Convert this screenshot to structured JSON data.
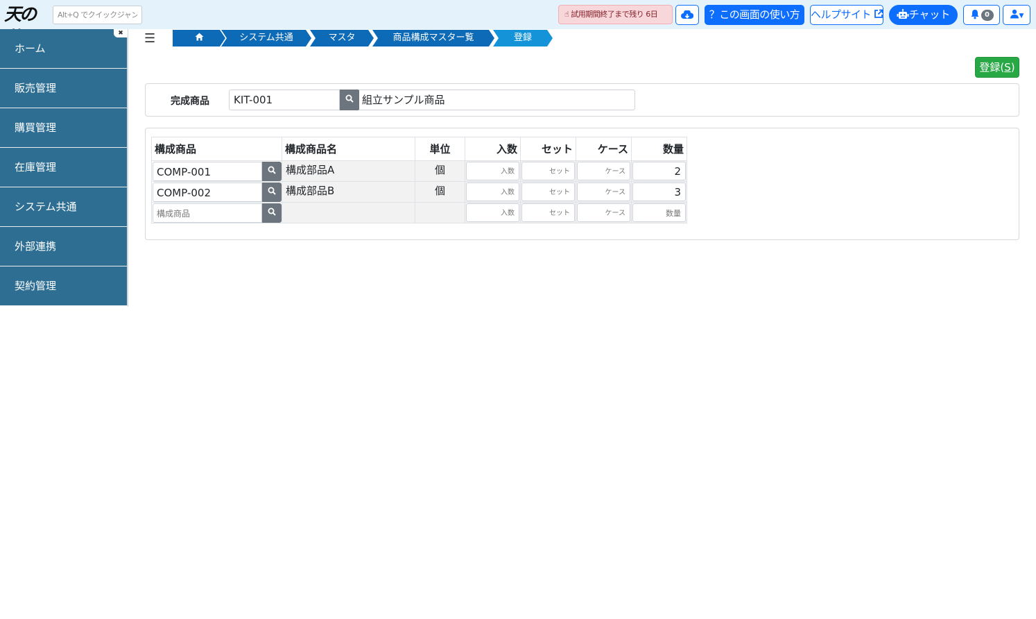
{
  "header": {
    "logo_text": "天の蔵",
    "quickjump_placeholder": "Alt+Q でクイックジャンプ",
    "trial_text": "試用期間終了まで残り 6日",
    "howto_label": "この画面の使い方",
    "help_label": "ヘルプサイト",
    "chat_label": "チャット",
    "notification_count": "0"
  },
  "sidebar": {
    "items": [
      {
        "label": "ホーム"
      },
      {
        "label": "販売管理"
      },
      {
        "label": "購買管理"
      },
      {
        "label": "在庫管理"
      },
      {
        "label": "システム共通"
      },
      {
        "label": "外部連携"
      },
      {
        "label": "契約管理"
      }
    ]
  },
  "breadcrumb": {
    "items": [
      {
        "label": "システム共通"
      },
      {
        "label": "マスタ"
      },
      {
        "label": "商品構成マスター覧"
      },
      {
        "label": "登録"
      }
    ]
  },
  "actions": {
    "register_label": "登録",
    "register_key": "S"
  },
  "finished_product": {
    "label": "完成商品",
    "code": "KIT-001",
    "name": "組立サンプル商品"
  },
  "grid": {
    "columns": {
      "code": "構成商品",
      "name": "構成商品名",
      "unit": "単位",
      "irisu": "入数",
      "set": "セット",
      "case": "ケース",
      "qty": "数量"
    },
    "rows": [
      {
        "code": "COMP-001",
        "name": "構成部品A",
        "unit": "個",
        "qty": "2"
      },
      {
        "code": "COMP-002",
        "name": "構成部品B",
        "unit": "個",
        "qty": "3"
      }
    ],
    "placeholders": {
      "code": "構成商品",
      "irisu": "入数",
      "set": "セット",
      "case": "ケース",
      "qty": "数量"
    }
  }
}
